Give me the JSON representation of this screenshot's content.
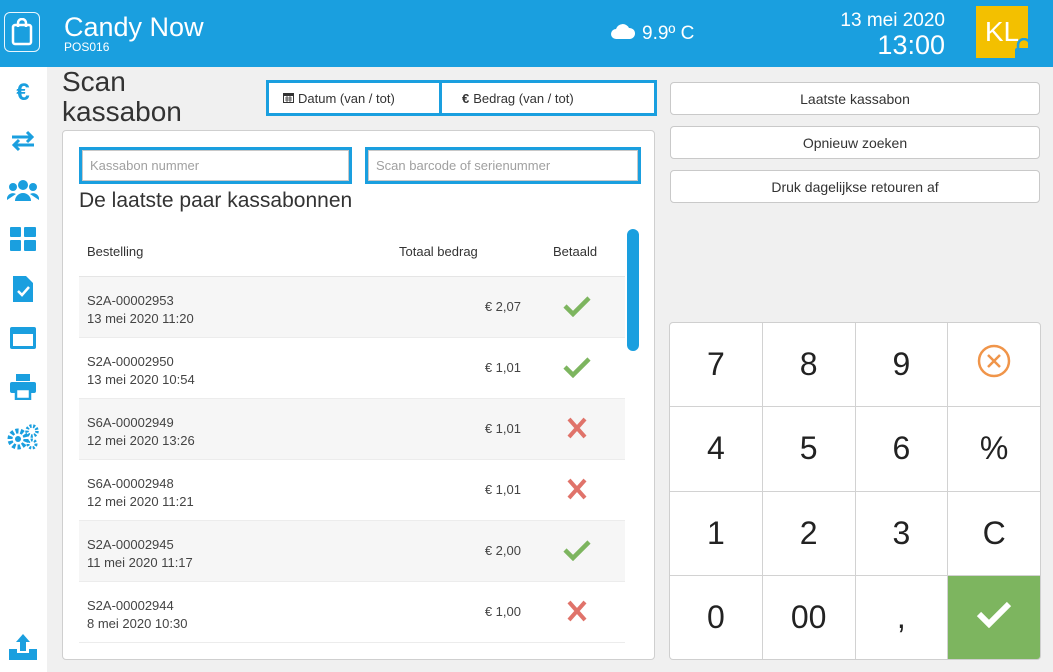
{
  "header": {
    "title": "Candy Now",
    "subtitle": "POS016",
    "weather": "9.9º C",
    "date": "13 mei 2020",
    "time": "13:00",
    "user_initials": "KL",
    "brand_color": "#1a9fdf",
    "avatar_color": "#f3c000"
  },
  "sidebar": {
    "items": [
      {
        "icon": "euro-icon"
      },
      {
        "icon": "exchange-arrows-icon"
      },
      {
        "icon": "users-group-icon"
      },
      {
        "icon": "grid-tiles-icon"
      },
      {
        "icon": "checklist-document-icon"
      },
      {
        "icon": "window-icon"
      },
      {
        "icon": "printer-icon"
      },
      {
        "icon": "settings-gears-icon"
      }
    ],
    "footer_icon": "upload-tray-icon"
  },
  "page": {
    "title": "Scan kassabon",
    "date_filter_label": "Datum (van / tot)",
    "amount_filter_label": "Bedrag (van / tot)",
    "receipt_number_placeholder": "Kassabon nummer",
    "barcode_placeholder": "Scan barcode of serienummer",
    "section_title": "De laatste paar kassabonnen"
  },
  "table": {
    "columns": [
      "Bestelling",
      "Totaal bedrag",
      "Betaald"
    ],
    "rows": [
      {
        "order": "S2A-00002953",
        "datetime": "13 mei 2020 11:20",
        "amount": "€ 2,07",
        "paid": true
      },
      {
        "order": "S2A-00002950",
        "datetime": "13 mei 2020 10:54",
        "amount": "€ 1,01",
        "paid": true
      },
      {
        "order": "S6A-00002949",
        "datetime": "12 mei 2020 13:26",
        "amount": "€ 1,01",
        "paid": false
      },
      {
        "order": "S6A-00002948",
        "datetime": "12 mei 2020 11:21",
        "amount": "€ 1,01",
        "paid": false
      },
      {
        "order": "S2A-00002945",
        "datetime": "11 mei 2020 11:17",
        "amount": "€ 2,00",
        "paid": true
      },
      {
        "order": "S2A-00002944",
        "datetime": "8 mei 2020 10:30",
        "amount": "€ 1,00",
        "paid": false
      }
    ],
    "paid_color": "#7db55f",
    "unpaid_color": "#e0736a"
  },
  "actions": {
    "last_receipt": "Laatste kassabon",
    "search_again": "Opnieuw zoeken",
    "print_returns": "Druk dagelijkse retouren af"
  },
  "keypad": {
    "keys": [
      "7",
      "8",
      "9",
      "",
      "4",
      "5",
      "6",
      "%",
      "1",
      "2",
      "3",
      "C",
      "0",
      "00",
      ",",
      ""
    ],
    "clear_icon_color": "#f0954a",
    "confirm_color": "#7db55f"
  }
}
